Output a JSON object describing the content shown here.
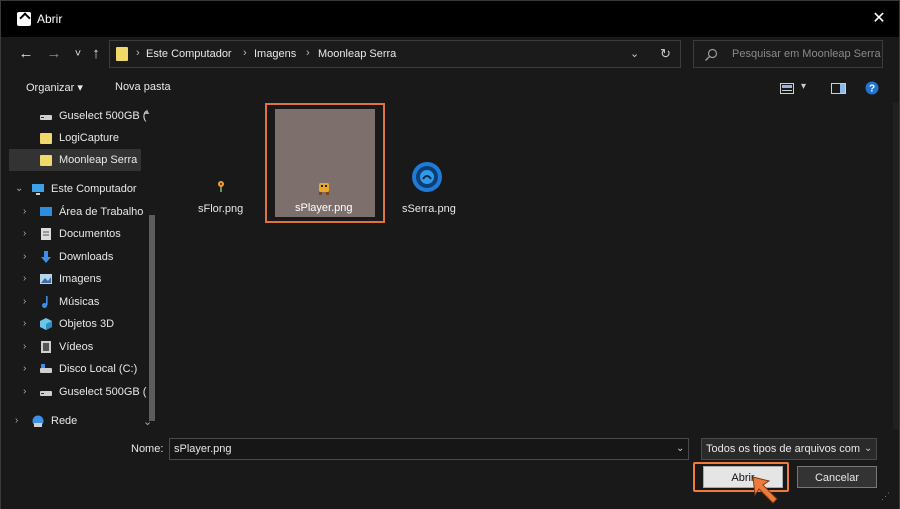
{
  "window": {
    "title": "Abrir",
    "close_glyph": "✕"
  },
  "nav": {
    "back_glyph": "←",
    "forward_glyph": "→",
    "recent_glyph": "˅",
    "up_glyph": "↑",
    "breadcrumbs": [
      "Este Computador",
      "Imagens",
      "Moonleap Serra"
    ],
    "separator": "›",
    "dropdown_glyph": "⌄",
    "refresh_glyph": "↻"
  },
  "search": {
    "placeholder": "Pesquisar em Moonleap Serra"
  },
  "toolbar": {
    "organize_label": "Organizar ▾",
    "new_folder_label": "Nova pasta",
    "view_dropdown_glyph": "▾",
    "help_glyph": "?"
  },
  "sidebar": {
    "items": [
      {
        "label": "Guselect 500GB (",
        "icon": "drive-icon",
        "chevron": ""
      },
      {
        "label": "LogiCapture",
        "icon": "folder-icon",
        "chevron": ""
      },
      {
        "label": "Moonleap Serra",
        "icon": "folder-icon",
        "chevron": ""
      },
      {
        "label": "Este Computador",
        "icon": "computer-icon",
        "chevron": "⌄"
      },
      {
        "label": "Área de Trabalho",
        "icon": "desktop-icon",
        "chevron": "›"
      },
      {
        "label": "Documentos",
        "icon": "documents-icon",
        "chevron": "›"
      },
      {
        "label": "Downloads",
        "icon": "downloads-icon",
        "chevron": "›"
      },
      {
        "label": "Imagens",
        "icon": "images-icon",
        "chevron": "›"
      },
      {
        "label": "Músicas",
        "icon": "music-icon",
        "chevron": "›"
      },
      {
        "label": "Objetos 3D",
        "icon": "objects3d-icon",
        "chevron": "›"
      },
      {
        "label": "Vídeos",
        "icon": "videos-icon",
        "chevron": "›"
      },
      {
        "label": "Disco Local (C:)",
        "icon": "disk-icon",
        "chevron": "›"
      },
      {
        "label": "Guselect 500GB (",
        "icon": "drive-icon",
        "chevron": "›"
      },
      {
        "label": "Rede",
        "icon": "network-icon",
        "chevron": "›"
      }
    ],
    "scroll_up_glyph": "▲",
    "scroll_down_glyph": "⌄"
  },
  "files": [
    {
      "name": "sFlor.png",
      "icon": "flower-sprite-icon"
    },
    {
      "name": "sPlayer.png",
      "icon": "player-sprite-icon"
    },
    {
      "name": "sSerra.png",
      "icon": "saw-sprite-icon"
    }
  ],
  "bottom": {
    "name_label": "Nome:",
    "name_value": "sPlayer.png",
    "dropdown_glyph": "⌄",
    "type_value": "Todos os tipos de arquivos com",
    "open_label": "Abrir",
    "cancel_label": "Cancelar",
    "grip_glyph": "⋰"
  },
  "colors": {
    "accent_highlight": "#f07a3a",
    "selected_tile": "#7d706c",
    "folder": "#f0d86a"
  }
}
